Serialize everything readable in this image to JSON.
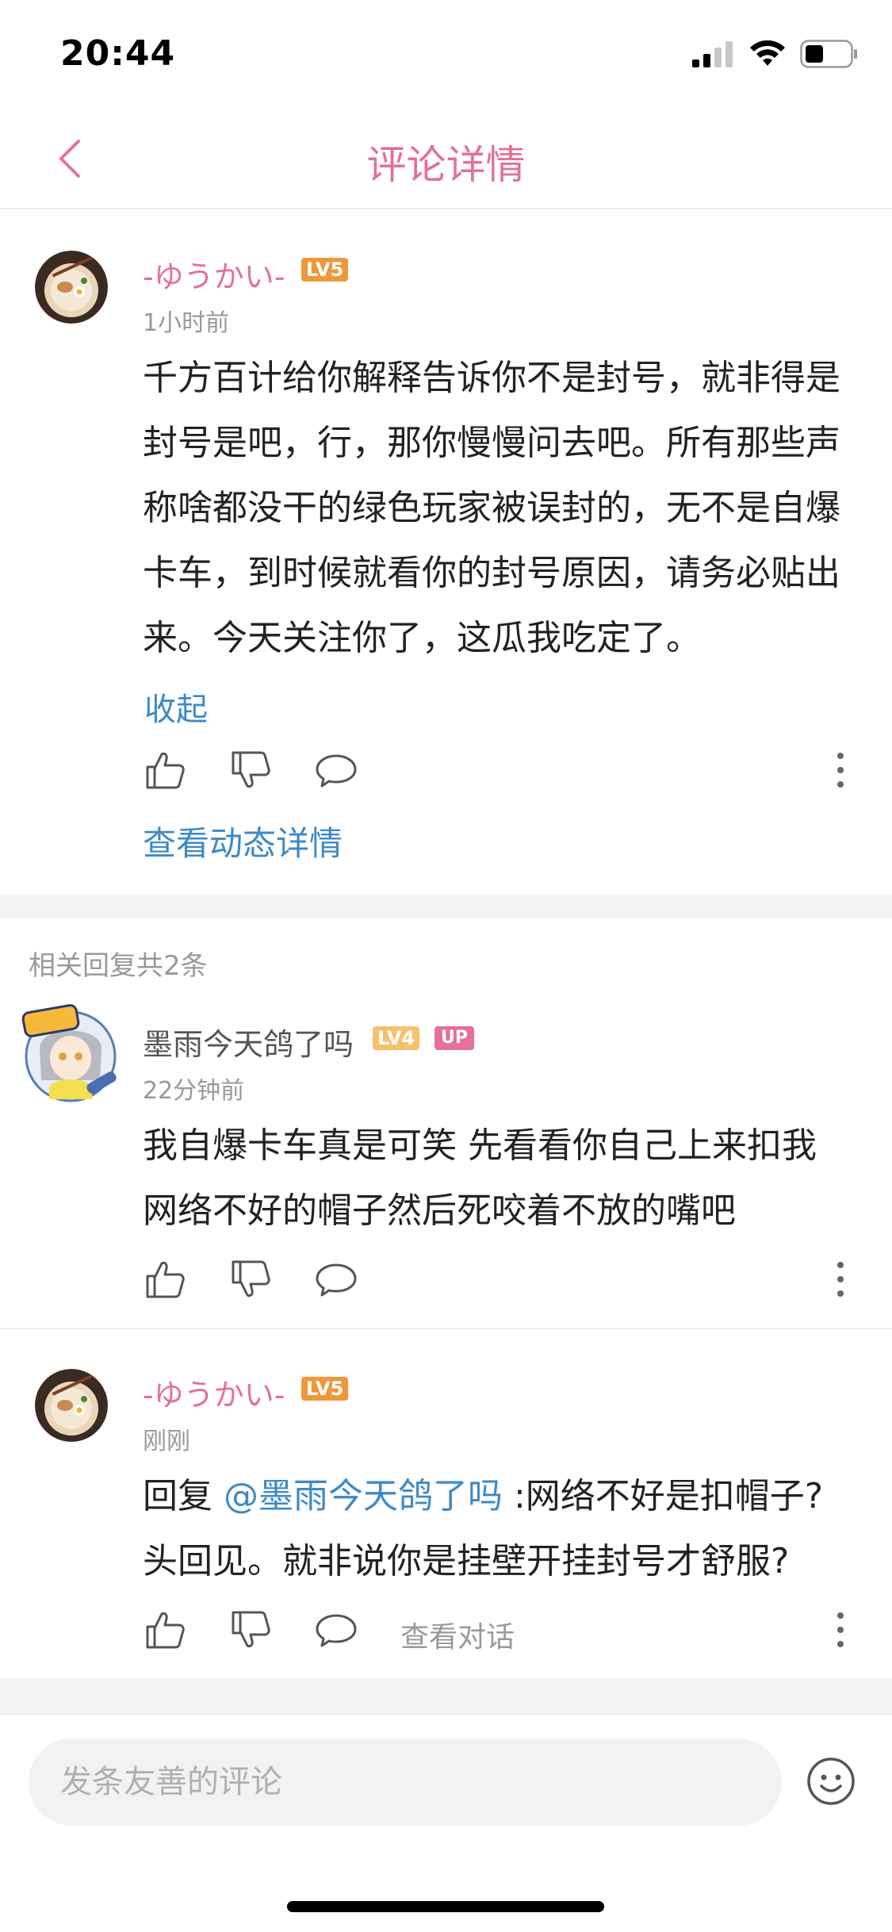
{
  "status_bar": {
    "time": "20:44"
  },
  "nav": {
    "title": "评论详情"
  },
  "main_comment": {
    "username": "-ゆうかい-",
    "level": "LV5",
    "time": "1小时前",
    "content_lines": [
      "千方百计给你解释告诉你不是封号，就非得是",
      "封号是吧，行，那你慢慢问去吧。所有那些声",
      "称啥都没干的绿色玩家被误封的，无不是自爆",
      "卡车，到时候就看你的封号原因，请务必贴出",
      "来。今天关注你了，这瓜我吃定了。"
    ],
    "collapse_label": "收起",
    "view_detail_label": "查看动态详情"
  },
  "replies": {
    "section_title": "相关回复共2条",
    "items": [
      {
        "username": "墨雨今天鸽了吗",
        "level": "LV4",
        "up_badge": "UP",
        "time": "22分钟前",
        "content_lines": [
          "我自爆卡车真是可笑 先看看你自己上来扣我",
          "网络不好的帽子然后死咬着不放的嘴吧"
        ]
      },
      {
        "username": "-ゆうかい-",
        "level": "LV5",
        "time": "刚刚",
        "reply_prefix": "回复 ",
        "mention": "@墨雨今天鸽了吗",
        "content_line1_rest": " :网络不好是扣帽子?",
        "content_line2": "头回见。就非说你是挂壁开挂封号才舒服?",
        "view_conversation_label": "查看对话"
      }
    ]
  },
  "input": {
    "placeholder": "发条友善的评论"
  },
  "colors": {
    "accent_pink": "#e4709b",
    "link_blue": "#3e8ac7",
    "lv5_orange": "#f0973a",
    "lv4_yellow": "#f5c26b"
  },
  "icons": [
    "signal-icon",
    "wifi-icon",
    "battery-icon",
    "back-icon",
    "like-icon",
    "dislike-icon",
    "comment-icon",
    "more-icon",
    "emoji-icon"
  ]
}
